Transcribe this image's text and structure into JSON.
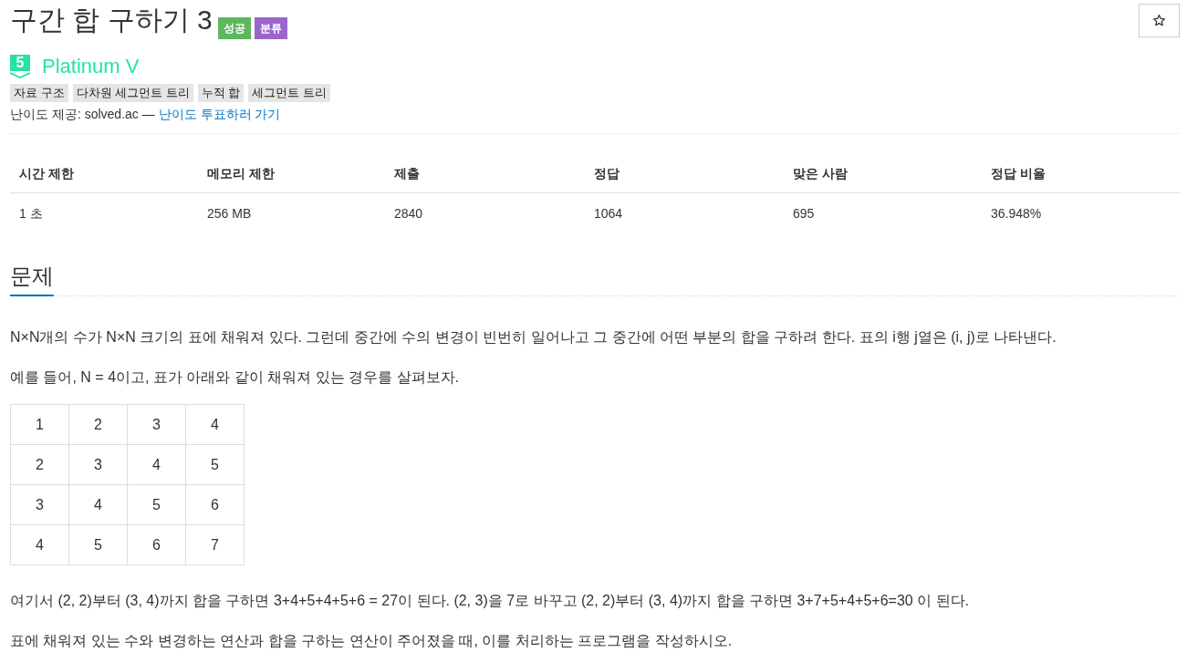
{
  "title": "구간 합 구하기 3",
  "badges": [
    {
      "label": "성공",
      "color": "#5cb85c"
    },
    {
      "label": "분류",
      "color": "#9b66cc"
    }
  ],
  "tier": {
    "level": "5",
    "name": "Platinum V"
  },
  "tags": [
    "자료 구조",
    "다차원 세그먼트 트리",
    "누적 합",
    "세그먼트 트리"
  ],
  "credit": {
    "text": "난이도 제공: solved.ac —",
    "link": "난이도 투표하러 가기"
  },
  "stats": {
    "columns": [
      "시간 제한",
      "메모리 제한",
      "제출",
      "정답",
      "맞은 사람",
      "정답 비율"
    ],
    "rows": [
      [
        "1 초",
        "256 MB",
        "2840",
        "1064",
        "695",
        "36.948%"
      ]
    ]
  },
  "section": {
    "title": "문제",
    "content": [
      {
        "kind": "paragraph",
        "text": "N×N개의 수가 N×N 크기의 표에 채워져 있다. 그런데 중간에 수의 변경이 빈번히 일어나고 그 중간에 어떤 부분의 합을 구하려 한다. 표의 i행 j열은 (i, j)로 나타낸다."
      },
      {
        "kind": "paragraph",
        "text": "예를 들어, N = 4이고, 표가 아래와 같이 채워져 있는 경우를 살펴보자."
      },
      {
        "kind": "grid",
        "rows": [
          [
            "1",
            "2",
            "3",
            "4"
          ],
          [
            "2",
            "3",
            "4",
            "5"
          ],
          [
            "3",
            "4",
            "5",
            "6"
          ],
          [
            "4",
            "5",
            "6",
            "7"
          ]
        ]
      },
      {
        "kind": "paragraph",
        "text": "여기서 (2, 2)부터 (3, 4)까지 합을 구하면 3+4+5+4+5+6 = 27이 된다. (2, 3)을 7로 바꾸고 (2, 2)부터 (3, 4)까지 합을 구하면 3+7+5+4+5+6=30 이 된다."
      },
      {
        "kind": "paragraph",
        "text": "표에 채워져 있는 수와 변경하는 연산과 합을 구하는 연산이 주어졌을 때, 이를 처리하는 프로그램을 작성하시오."
      }
    ]
  }
}
